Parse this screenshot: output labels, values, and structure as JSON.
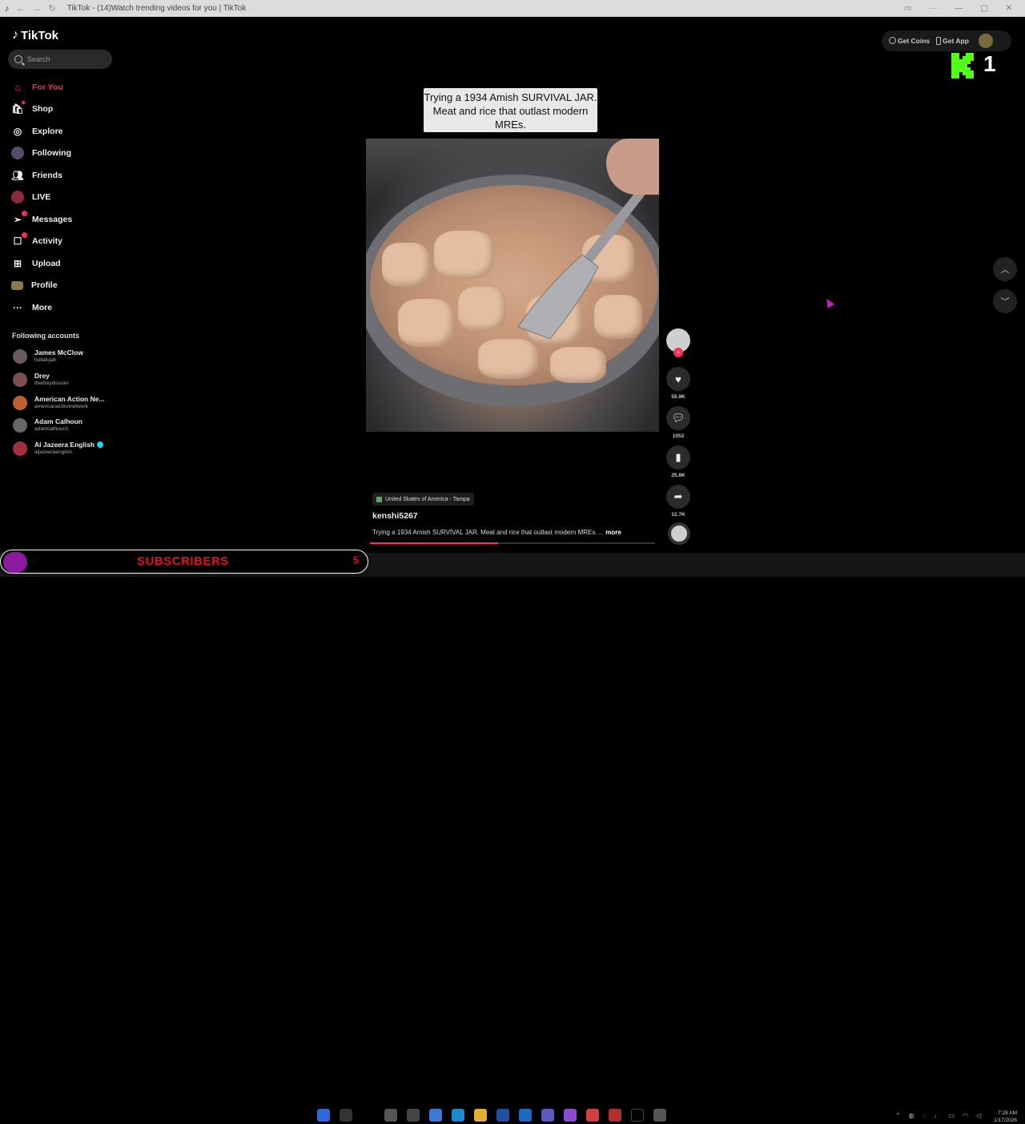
{
  "browser": {
    "tab_title": "TikTok - (14)Watch trending videos for you | TikTok",
    "nav_icons": [
      "browser-back-icon",
      "browser-forward-icon",
      "reload-icon"
    ]
  },
  "sidebar": {
    "logo_text": "TikTok",
    "search_placeholder": "Search",
    "nav_items": [
      {
        "label": "For You",
        "icon": "home-icon",
        "active": true
      },
      {
        "label": "Shop",
        "icon": "shopping-bag-icon"
      },
      {
        "label": "Explore",
        "icon": "compass-icon"
      },
      {
        "label": "Following",
        "icon": "following-avatar-icon"
      },
      {
        "label": "Friends",
        "icon": "friends-icon"
      },
      {
        "label": "LIVE",
        "icon": "live-icon"
      },
      {
        "label": "Messages",
        "icon": "paper-plane-icon"
      },
      {
        "label": "Activity",
        "icon": "activity-icon"
      },
      {
        "label": "Upload",
        "icon": "plus-box-icon"
      },
      {
        "label": "Profile",
        "icon": "profile-avatar-icon"
      },
      {
        "label": "More",
        "icon": "ellipsis-icon"
      }
    ],
    "following_title": "Following accounts",
    "accounts": [
      {
        "name": "James McClow",
        "handle": "hullalujah"
      },
      {
        "name": "Drey",
        "handle": "thedreydossier"
      },
      {
        "name": "American Action Ne...",
        "handle": "americanactionnetwork"
      },
      {
        "name": "Adam Calhoun",
        "handle": "adamcalhoun1"
      },
      {
        "name": "Al Jazeera English",
        "handle": "aljazeeraenglish",
        "verified": true
      }
    ]
  },
  "header": {
    "get_coins": "Get Coins",
    "get_app": "Get App"
  },
  "overlay": {
    "kick_count": "1"
  },
  "video": {
    "caption": "Trying a 1934 Amish SURVIVAL JAR. Meat and rice that outlast modern MREs.",
    "location": "United Skates of America - Tampa",
    "username": "kenshi5267",
    "description": "Trying a 1934 Amish SURVIVAL JAR. Meat and rice that outlast modern MREs. ..",
    "more_label": "more",
    "progress_fraction": 0.45
  },
  "actions": {
    "likes": "55.9K",
    "comments": "1052",
    "saves": "25.8K",
    "shares": "12.7K"
  },
  "stream_overlay": {
    "subscribers_label": "SUBSCRIBERS",
    "subscribers_count": "5"
  },
  "taskbar": {
    "time": "7:28 AM",
    "date": "1/17/2026"
  },
  "colors": {
    "accent": "#fe2c55",
    "background": "#000000",
    "kick_green": "#53fc18"
  }
}
